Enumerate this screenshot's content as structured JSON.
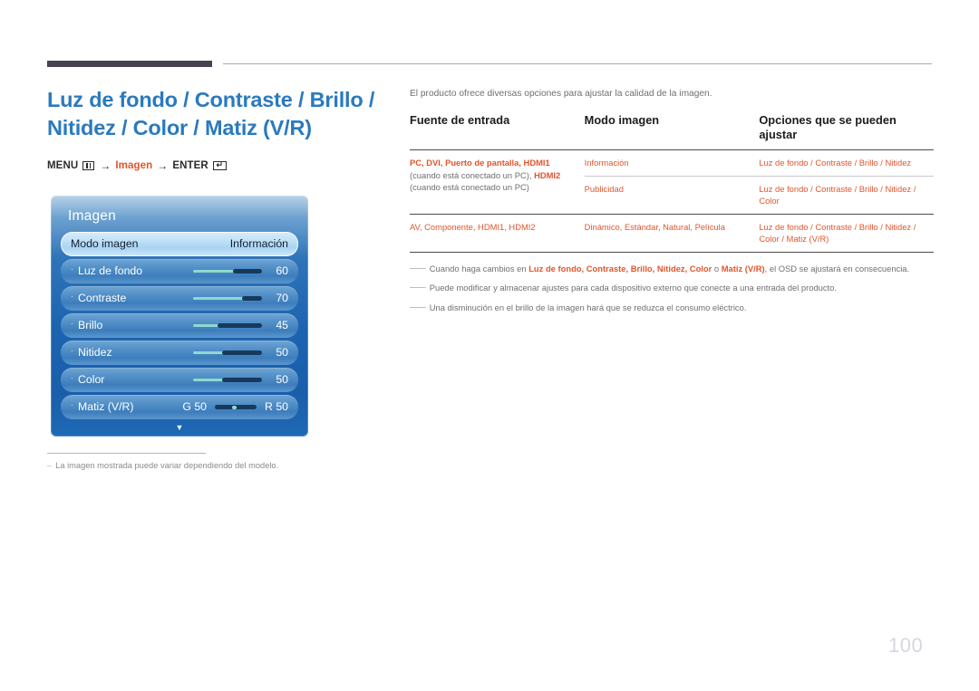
{
  "header": {
    "title": "Luz de fondo / Contraste / Brillo / Nitidez / Color / Matiz (V/R)",
    "menu_path": {
      "menu_label": "MENU",
      "menu_icon": "menu-grid-icon",
      "arrow1": "→",
      "middle_label": "Imagen",
      "arrow2": "→",
      "enter_label": "ENTER",
      "enter_icon": "enter-return-icon"
    }
  },
  "osd": {
    "title": "Imagen",
    "rows": [
      {
        "label": "Modo imagen",
        "value": "Información",
        "selected": true,
        "type": "value"
      },
      {
        "label": "Luz de fondo",
        "value": "60",
        "type": "slider",
        "fill_pct": 60
      },
      {
        "label": "Contraste",
        "value": "70",
        "type": "slider",
        "fill_pct": 70
      },
      {
        "label": "Brillo",
        "value": "45",
        "type": "slider",
        "fill_pct": 45
      },
      {
        "label": "Nitidez",
        "value": "50",
        "type": "slider",
        "fill_pct": 50
      },
      {
        "label": "Color",
        "value": "50",
        "type": "slider",
        "fill_pct": 50
      },
      {
        "label": "Matiz (V/R)",
        "left_value": "G 50",
        "right_value": "R 50",
        "type": "dual"
      }
    ],
    "scroll_arrow": "▼"
  },
  "left_note": {
    "dash": "–",
    "text": "La imagen mostrada puede variar dependiendo del modelo."
  },
  "right": {
    "intro": "El producto ofrece diversas opciones para ajustar la calidad de la imagen.",
    "table": {
      "headers": [
        "Fuente de entrada",
        "Modo imagen",
        "Opciones que se pueden ajustar"
      ],
      "rows": [
        {
          "source_parts": [
            {
              "text": "PC, DVI, Puerto de pantalla, HDMI1",
              "style": "orange-b"
            },
            {
              "text": "(cuando está conectado un PC),",
              "style": "gray"
            },
            {
              "text": "HDMI2",
              "style": "orange-b"
            },
            {
              "text": " (cuando está conectado un PC)",
              "style": "gray"
            }
          ],
          "mode": "Información",
          "options": "Luz de fondo / Contraste / Brillo / Nitidez"
        },
        {
          "source_parts": [],
          "mode": "Publicidad",
          "options": "Luz de fondo / Contraste / Brillo / Nitidez / Color"
        },
        {
          "source_parts": [
            {
              "text": "AV, Componente, HDMI1, HDMI2",
              "style": "orange-b"
            }
          ],
          "mode": "Dinámico, Estándar, Natural, Película",
          "options": "Luz de fondo / Contraste / Brillo / Nitidez / Color / Matiz (V/R)"
        }
      ]
    },
    "notes": [
      {
        "dash": "――",
        "pre": "Cuando haga cambios en ",
        "bold": "Luz de fondo, Contraste, Brillo, Nitidez, Color",
        "mid": " o ",
        "bold2": "Matiz (V/R)",
        "post": ", el OSD se ajustará en consecuencia."
      },
      {
        "dash": "――",
        "pre": "Puede modificar y almacenar ajustes para cada dispositivo externo que conecte a una entrada del producto.",
        "bold": "",
        "mid": "",
        "bold2": "",
        "post": ""
      },
      {
        "dash": "――",
        "pre": "Una disminución en el brillo de la imagen hará que se reduzca el consumo eléctrico.",
        "bold": "",
        "mid": "",
        "bold2": "",
        "post": ""
      }
    ]
  },
  "page_number": "100"
}
